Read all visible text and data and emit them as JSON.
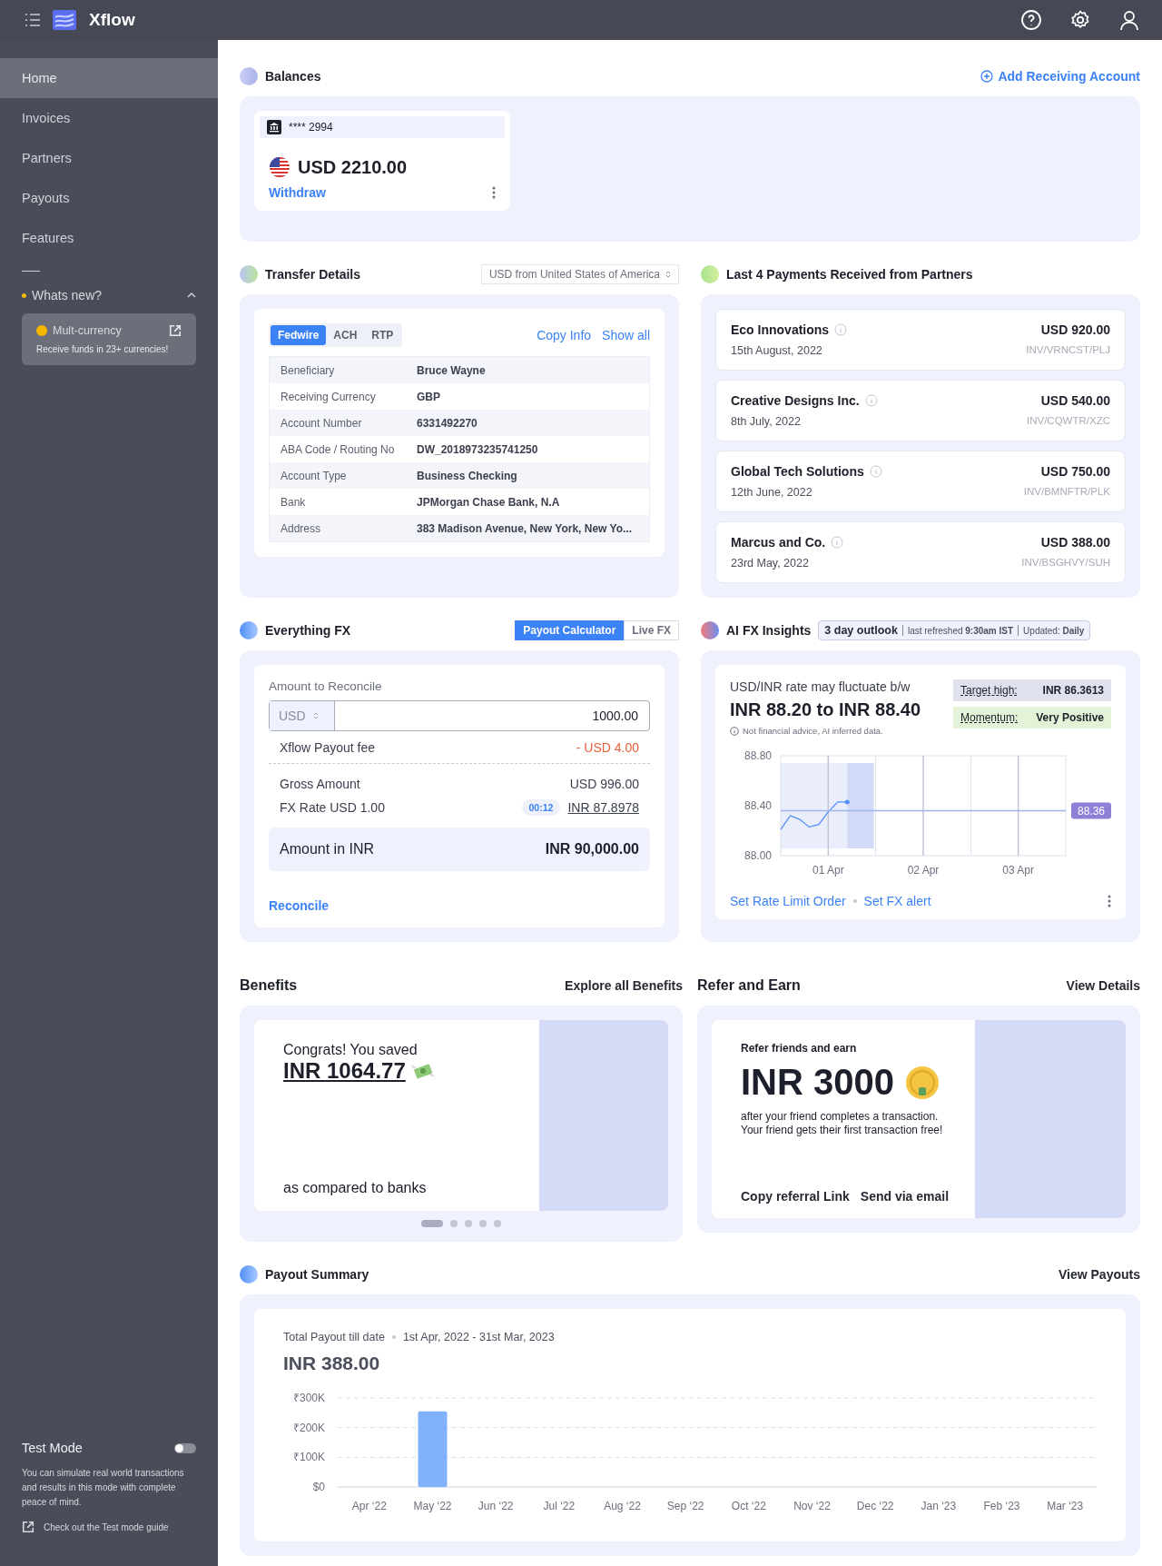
{
  "header": {
    "logo": "Xflow"
  },
  "sidebar": {
    "items": [
      {
        "label": "Home",
        "selected": true
      },
      {
        "label": "Invoices",
        "selected": false
      },
      {
        "label": "Partners",
        "selected": false
      },
      {
        "label": "Payouts",
        "selected": false
      },
      {
        "label": "Features",
        "selected": false
      }
    ],
    "whats_new": {
      "label": "Whats new?",
      "expanded": true,
      "card": {
        "title": "Mult-currency",
        "text": "Receive funds in 23+ currencies!"
      }
    },
    "test_mode": {
      "label": "Test Mode",
      "on": false,
      "text": "You can simulate real world transactions and results in this mode with complete peace of mind.",
      "link": "Check out the Test mode guide"
    }
  },
  "balances": {
    "title": "Balances",
    "action": "Add Receiving Account",
    "accounts": [
      {
        "number": "**** 2994",
        "amount": "USD 2210.00",
        "action": "Withdraw"
      }
    ]
  },
  "transfer_details": {
    "title": "Transfer Details",
    "currency_select": "USD from United States of America",
    "tabs": [
      {
        "label": "Fedwire",
        "selected": true
      },
      {
        "label": "ACH",
        "selected": false
      },
      {
        "label": "RTP",
        "selected": false
      }
    ],
    "actions": [
      "Copy Info",
      "Show all"
    ],
    "rows": [
      {
        "label": "Beneficiary",
        "value": "Bruce Wayne"
      },
      {
        "label": "Receiving Currency",
        "value": "GBP"
      },
      {
        "label": "Account Number",
        "value": "6331492270"
      },
      {
        "label": "ABA Code / Routing No",
        "value": "DW_2018973235741250"
      },
      {
        "label": "Account Type",
        "value": "Business Checking"
      },
      {
        "label": "Bank",
        "value": "JPMorgan Chase Bank, N.A"
      },
      {
        "label": "Address",
        "value": "383 Madison Avenue, New York, New Yo..."
      }
    ]
  },
  "payments": {
    "title": "Last 4 Payments Received from Partners",
    "items": [
      {
        "name": "Eco Innovations",
        "date": "15th August, 2022",
        "amount": "USD 920.00",
        "reference": "INV/VRNCST/PLJ"
      },
      {
        "name": "Creative Designs Inc.",
        "date": "8th July, 2022",
        "amount": "USD 540.00",
        "reference": "INV/CQWTR/XZC"
      },
      {
        "name": "Global Tech Solutions",
        "date": "12th June, 2022",
        "amount": "USD 750.00",
        "reference": "INV/BMNFTR/PLK"
      },
      {
        "name": "Marcus and Co.",
        "date": "23rd May, 2022",
        "amount": "USD 388.00",
        "reference": "INV/BSGHVY/SUH"
      }
    ]
  },
  "fx": {
    "title": "Everything FX",
    "tabs": [
      {
        "label": "Payout Calculator",
        "selected": true
      },
      {
        "label": "Live FX",
        "selected": false
      }
    ],
    "amount_label": "Amount to Reconcile",
    "currency": "USD",
    "amount": "1000.00",
    "fee_label": "Xflow Payout fee",
    "fee": "- USD 4.00",
    "gross_label": "Gross Amount",
    "gross": "USD 996.00",
    "rate_label": "FX Rate USD 1.00",
    "timer": "00:12",
    "rate": "INR 87.8978",
    "result_label": "Amount in INR",
    "result": "INR 90,000.00",
    "action": "Reconcile"
  },
  "insights": {
    "title": "AI FX Insights",
    "outlook": "3 day outlook",
    "refreshed": "last refreshed **9:30am IST**",
    "updated": "Updated: **Daily**",
    "headline": "USD/INR rate may fluctuate b/w",
    "range": "INR 88.20 to INR 88.40",
    "disclaimer": "Not financial advice, AI inferred data.",
    "tags": [
      {
        "label": "Target high:",
        "value": "INR 86.3613",
        "color": "#dfe1ef"
      },
      {
        "label": "Momentum:",
        "value": "Very Positive",
        "color": "#e4f2d8"
      }
    ],
    "chart_data": {
      "type": "line",
      "ylim": [
        88.0,
        88.8
      ],
      "yticks": [
        {
          "value": 88.8,
          "label": "88.80"
        },
        {
          "value": 88.4,
          "label": "88.40"
        },
        {
          "value": 88.0,
          "label": "88.00"
        }
      ],
      "categories": [
        null,
        null,
        null,
        null,
        null,
        "01 Apr",
        null,
        null,
        null,
        null,
        null,
        null,
        null,
        null,
        null,
        "02 Apr",
        null,
        null,
        null,
        null,
        null,
        null,
        null,
        null,
        null,
        "03 Apr",
        null,
        null,
        null,
        null,
        null
      ],
      "series": [
        {
          "color": "#4f8ff7",
          "values": [
            88.21,
            88.32,
            88.29,
            88.23,
            88.25,
            88.35,
            88.43,
            88.43,
            null,
            null,
            null,
            null,
            null,
            null,
            null,
            null,
            null,
            null,
            null,
            null,
            null,
            null,
            null,
            null,
            null,
            null,
            null,
            null,
            null,
            null,
            null
          ]
        },
        {
          "color": "#9fb5ee",
          "values": [
            88.36,
            88.36,
            88.36,
            88.36,
            88.36,
            88.36,
            88.36,
            88.36,
            88.36,
            88.36,
            88.36,
            88.36,
            88.36,
            88.36,
            88.36,
            88.36,
            88.36,
            88.36,
            88.36,
            88.36,
            88.36,
            88.36,
            88.36,
            88.36,
            88.36,
            88.36,
            88.36,
            88.36,
            88.36,
            88.36,
            88.36
          ]
        }
      ],
      "grid": true,
      "annotations": [
        "88.36"
      ]
    },
    "actions": [
      "Set Rate Limit Order",
      "Set FX alert"
    ]
  },
  "benefits": {
    "title": "Benefits",
    "action": "Explore all Benefits",
    "intro": "Congrats! You saved",
    "amount": "INR 1064.77",
    "note": "as compared to banks",
    "pages": [
      {
        "selected": true
      },
      {
        "selected": false
      },
      {
        "selected": false
      },
      {
        "selected": false
      },
      {
        "selected": false
      }
    ]
  },
  "refer": {
    "title": "Refer and Earn",
    "action": "View Details",
    "intro": "Refer friends and earn",
    "amount": "INR 3000",
    "text": "after your friend completes a transaction.",
    "text_2": "Your friend gets their first transaction free!",
    "actions": [
      "Copy referral Link",
      "Send via email"
    ]
  },
  "payout_summary": {
    "title": "Payout Summary",
    "action": "View Payouts",
    "label": "Total Payout till date",
    "period": "1st Apr, 2022 - 31st Mar, 2023",
    "total": "INR 388.00",
    "chart_data": {
      "type": "bar",
      "categories": [
        "Apr ‘22",
        "May ‘22",
        "Jun ‘22",
        "Jul ‘22",
        "Aug ‘22",
        "Sep ‘22",
        "Oct ‘22",
        "Nov ‘22",
        "Dec ‘22",
        "Jan ‘23",
        "Feb ‘23",
        "Mar ‘23"
      ],
      "ylim": [
        0,
        300000
      ],
      "yticks": [
        {
          "value": 300000,
          "label": "₹300K"
        },
        {
          "value": 200000,
          "label": "₹200K"
        },
        {
          "value": 100000,
          "label": "₹100K"
        },
        {
          "value": 0,
          "label": "$0"
        }
      ],
      "series": [
        {
          "color": "#80b1fb",
          "values": [
            0,
            255000,
            0,
            0,
            0,
            0,
            0,
            0,
            0,
            0,
            0,
            0
          ]
        }
      ]
    }
  }
}
